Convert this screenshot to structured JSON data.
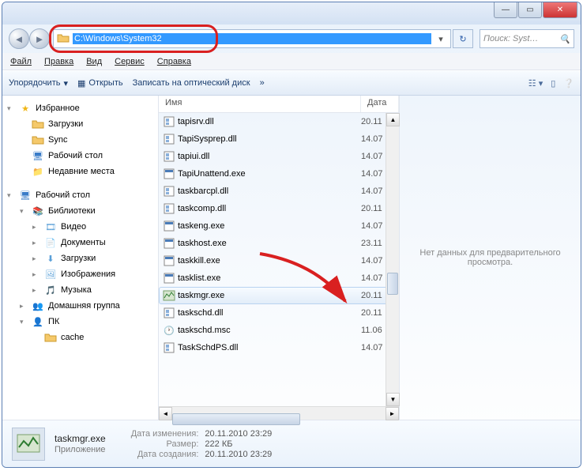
{
  "titlebar": {},
  "address": {
    "path": "C:\\Windows\\System32"
  },
  "search": {
    "placeholder": "Поиск: Syst…"
  },
  "menu": {
    "file": "Файл",
    "edit": "Правка",
    "view": "Вид",
    "tools": "Сервис",
    "help": "Справка"
  },
  "toolbar": {
    "organize": "Упорядочить",
    "open": "Открыть",
    "burn": "Записать на оптический диск"
  },
  "sidebar": {
    "favorites": "Избранное",
    "fav_items": [
      {
        "label": "Загрузки",
        "icon": "folder"
      },
      {
        "label": "Sync",
        "icon": "folder"
      },
      {
        "label": "Рабочий стол",
        "icon": "desktop"
      },
      {
        "label": "Недавние места",
        "icon": "recent"
      }
    ],
    "desktop": "Рабочий стол",
    "libraries": "Библиотеки",
    "lib_items": [
      {
        "label": "Видео",
        "icon": "video"
      },
      {
        "label": "Документы",
        "icon": "doc"
      },
      {
        "label": "Загрузки",
        "icon": "download"
      },
      {
        "label": "Изображения",
        "icon": "image"
      },
      {
        "label": "Музыка",
        "icon": "music"
      }
    ],
    "homegroup": "Домашняя группа",
    "pc": "ПК",
    "cache": "cache"
  },
  "list": {
    "col_name": "Имя",
    "col_date": "Дата",
    "files": [
      {
        "name": "tapisrv.dll",
        "date": "20.11",
        "type": "dll"
      },
      {
        "name": "TapiSysprep.dll",
        "date": "14.07",
        "type": "dll"
      },
      {
        "name": "tapiui.dll",
        "date": "14.07",
        "type": "dll"
      },
      {
        "name": "TapiUnattend.exe",
        "date": "14.07",
        "type": "exe"
      },
      {
        "name": "taskbarcpl.dll",
        "date": "14.07",
        "type": "dll"
      },
      {
        "name": "taskcomp.dll",
        "date": "20.11",
        "type": "dll"
      },
      {
        "name": "taskeng.exe",
        "date": "14.07",
        "type": "exe"
      },
      {
        "name": "taskhost.exe",
        "date": "23.11",
        "type": "exe"
      },
      {
        "name": "taskkill.exe",
        "date": "14.07",
        "type": "exe"
      },
      {
        "name": "tasklist.exe",
        "date": "14.07",
        "type": "exe"
      },
      {
        "name": "taskmgr.exe",
        "date": "20.11",
        "type": "taskmgr",
        "selected": true
      },
      {
        "name": "taskschd.dll",
        "date": "20.11",
        "type": "dll"
      },
      {
        "name": "taskschd.msc",
        "date": "11.06",
        "type": "msc"
      },
      {
        "name": "TaskSchdPS.dll",
        "date": "14.07",
        "type": "dll"
      }
    ]
  },
  "preview": {
    "text": "Нет данных для предварительного просмотра."
  },
  "details": {
    "name": "taskmgr.exe",
    "type": "Приложение",
    "modified_label": "Дата изменения:",
    "modified": "20.11.2010 23:29",
    "size_label": "Размер:",
    "size": "222 КБ",
    "created_label": "Дата создания:",
    "created": "20.11.2010 23:29"
  }
}
